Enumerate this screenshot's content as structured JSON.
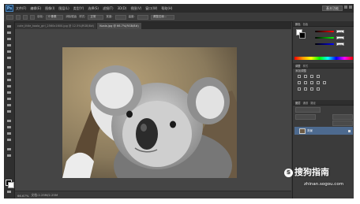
{
  "menubar": {
    "logo": "Ps",
    "items": [
      "文件(F)",
      "编辑(E)",
      "图像(I)",
      "图层(L)",
      "类型(Y)",
      "选择(S)",
      "滤镜(T)",
      "3D(D)",
      "视图(V)",
      "窗口(W)",
      "帮助(H)"
    ],
    "workspace_label": "基本功能"
  },
  "options_bar": {
    "feather_label": "羽化:",
    "feather_value": "0 像素",
    "antialias_label": "消除锯齿",
    "style_label": "样式:",
    "style_value": "正常",
    "width_label": "宽度:",
    "height_label": "高度:",
    "refine_button": "调整边缘..."
  },
  "tabs": [
    {
      "label": "cute_little_koala_girl_2560x1600.jpg @ 12.5%(RGB/8#)",
      "active": false
    },
    {
      "label": "Koala.jpg @ 66.7%(RGB/8#)",
      "active": true
    }
  ],
  "status": {
    "zoom": "66.67%",
    "doc_size": "文档:2.25M/2.25M"
  },
  "panels": {
    "color_tabs": [
      "颜色",
      "色板"
    ],
    "rgb_values": [
      "225",
      "209",
      "220"
    ],
    "adjust_tabs": [
      "调整",
      "样式"
    ],
    "adjust_title": "添加调整",
    "layers_tabs": [
      "图层",
      "通道",
      "路径"
    ],
    "layer_name": "背景"
  },
  "watermark": {
    "brand": "搜狗指南",
    "url": "zhinan.sogou.com"
  },
  "colors": {
    "app_bg": "#3a3a3a",
    "menubar_bg": "#2b2b2b",
    "selected_layer": "#4d6a8f"
  }
}
